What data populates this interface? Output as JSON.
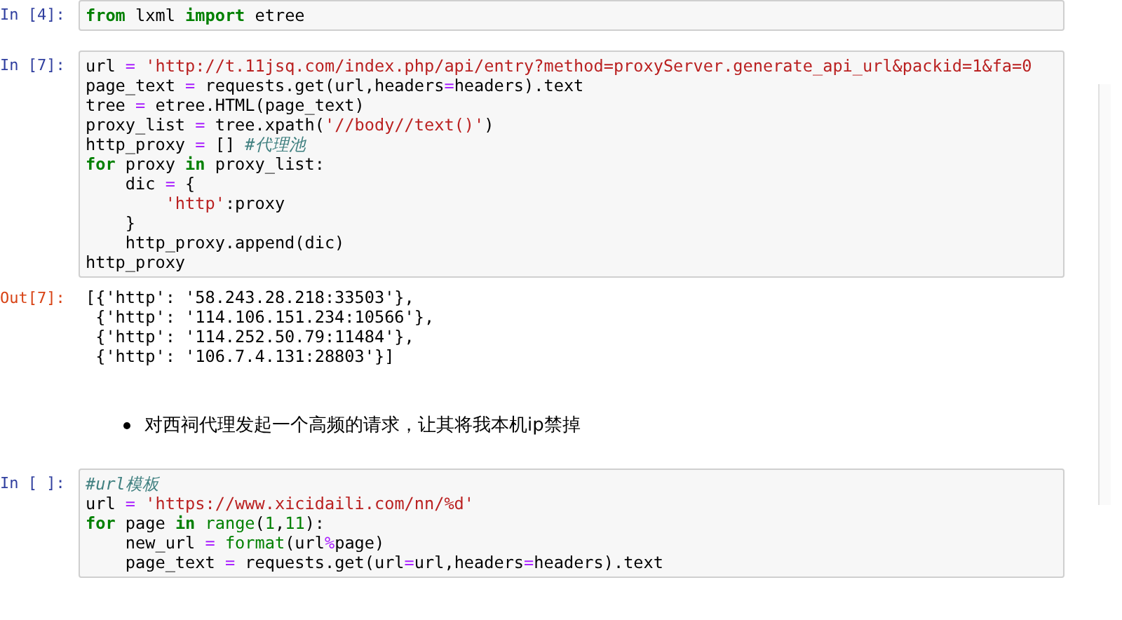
{
  "cells": [
    {
      "kind": "code",
      "prompt": "In [4]:",
      "lines": [
        [
          {
            "kind": "kw",
            "text": "from"
          },
          {
            "kind": "plain",
            "text": " lxml "
          },
          {
            "kind": "kw",
            "text": "import"
          },
          {
            "kind": "plain",
            "text": " etree"
          }
        ]
      ]
    },
    {
      "kind": "code",
      "prompt": "In [7]:",
      "lines": [
        [
          {
            "kind": "plain",
            "text": "url "
          },
          {
            "kind": "op",
            "text": "="
          },
          {
            "kind": "str",
            "text": " 'http://t.11jsq.com/index.php/api/entry?method=proxyServer.generate_api_url&packid=1&fa=0"
          }
        ],
        [
          {
            "kind": "plain",
            "text": "page_text "
          },
          {
            "kind": "op",
            "text": "="
          },
          {
            "kind": "plain",
            "text": " requests.get(url,headers"
          },
          {
            "kind": "op",
            "text": "="
          },
          {
            "kind": "plain",
            "text": "headers).text"
          }
        ],
        [
          {
            "kind": "plain",
            "text": "tree "
          },
          {
            "kind": "op",
            "text": "="
          },
          {
            "kind": "plain",
            "text": " etree.HTML(page_text)"
          }
        ],
        [
          {
            "kind": "plain",
            "text": "proxy_list "
          },
          {
            "kind": "op",
            "text": "="
          },
          {
            "kind": "plain",
            "text": " tree.xpath("
          },
          {
            "kind": "str",
            "text": "'//body//text()'"
          },
          {
            "kind": "plain",
            "text": ")"
          }
        ],
        [
          {
            "kind": "plain",
            "text": "http_proxy "
          },
          {
            "kind": "op",
            "text": "="
          },
          {
            "kind": "plain",
            "text": " [] "
          },
          {
            "kind": "cm",
            "text": "#代理池"
          }
        ],
        [
          {
            "kind": "kw",
            "text": "for"
          },
          {
            "kind": "plain",
            "text": " proxy "
          },
          {
            "kind": "kw",
            "text": "in"
          },
          {
            "kind": "plain",
            "text": " proxy_list:"
          }
        ],
        [
          {
            "kind": "plain",
            "text": "    dic "
          },
          {
            "kind": "op",
            "text": "="
          },
          {
            "kind": "plain",
            "text": " {"
          }
        ],
        [
          {
            "kind": "str",
            "text": "        'http'"
          },
          {
            "kind": "plain",
            "text": ":proxy"
          }
        ],
        [
          {
            "kind": "plain",
            "text": "    }"
          }
        ],
        [
          {
            "kind": "plain",
            "text": "    http_proxy.append(dic)"
          }
        ],
        [
          {
            "kind": "plain",
            "text": "http_proxy"
          }
        ]
      ],
      "output": {
        "prompt": "Out[7]:",
        "lines": [
          "[{'http': '58.243.28.218:33503'},",
          " {'http': '114.106.151.234:10566'},",
          " {'http': '114.252.50.79:11484'},",
          " {'http': '106.7.4.131:28803'}]"
        ]
      }
    },
    {
      "kind": "markdown",
      "bullets": [
        "对西祠代理发起一个高频的请求，让其将我本机ip禁掉"
      ]
    },
    {
      "kind": "code",
      "prompt": "In [ ]:",
      "lines": [
        [
          {
            "kind": "cm",
            "text": "#url模板"
          }
        ],
        [
          {
            "kind": "plain",
            "text": "url "
          },
          {
            "kind": "op",
            "text": "="
          },
          {
            "kind": "str",
            "text": " 'https://www.xicidaili.com/nn/%d'"
          }
        ],
        [
          {
            "kind": "kw",
            "text": "for"
          },
          {
            "kind": "plain",
            "text": " page "
          },
          {
            "kind": "kw",
            "text": "in"
          },
          {
            "kind": "builtin",
            "text": " range"
          },
          {
            "kind": "plain",
            "text": "("
          },
          {
            "kind": "num",
            "text": "1"
          },
          {
            "kind": "plain",
            "text": ","
          },
          {
            "kind": "num",
            "text": "11"
          },
          {
            "kind": "plain",
            "text": "):"
          }
        ],
        [
          {
            "kind": "plain",
            "text": "    new_url "
          },
          {
            "kind": "op",
            "text": "="
          },
          {
            "kind": "builtin",
            "text": " format"
          },
          {
            "kind": "plain",
            "text": "(url"
          },
          {
            "kind": "op",
            "text": "%"
          },
          {
            "kind": "plain",
            "text": "page)"
          }
        ],
        [
          {
            "kind": "plain",
            "text": "    page_text "
          },
          {
            "kind": "op",
            "text": "="
          },
          {
            "kind": "plain",
            "text": " requests.get(url"
          },
          {
            "kind": "op",
            "text": "="
          },
          {
            "kind": "plain",
            "text": "url,headers"
          },
          {
            "kind": "op",
            "text": "="
          },
          {
            "kind": "plain",
            "text": "headers).text"
          }
        ]
      ]
    }
  ]
}
